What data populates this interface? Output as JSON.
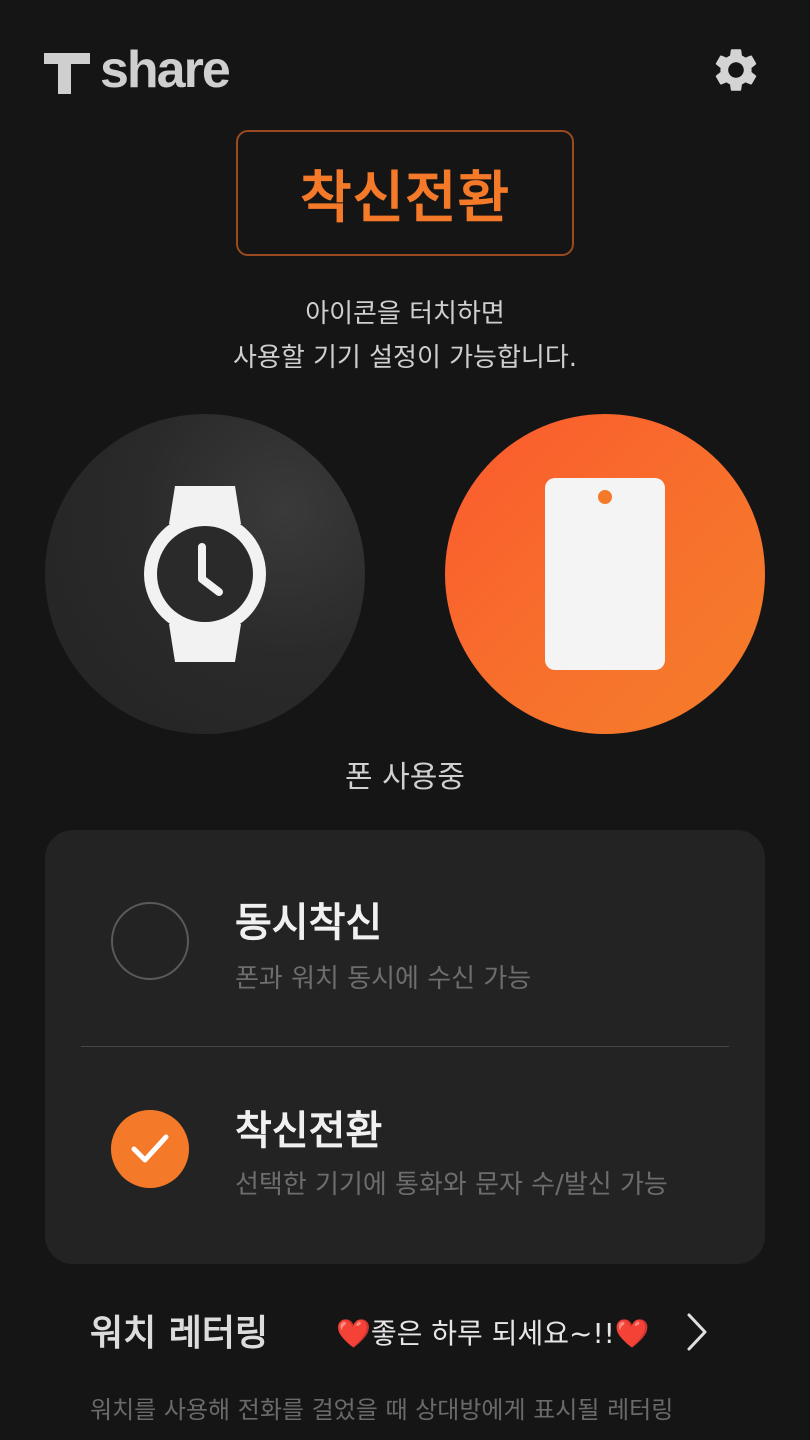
{
  "header": {
    "logo_text": "share",
    "settings_icon": "gear-icon"
  },
  "mode_badge": "착신전환",
  "hint": {
    "line1": "아이콘을 터치하면",
    "line2": "사용할 기기 설정이 가능합니다."
  },
  "devices": {
    "watch": {
      "icon": "watch-icon",
      "selected": false
    },
    "phone": {
      "icon": "phone-icon",
      "selected": true,
      "accent": "#f47a2a"
    }
  },
  "status_text": "폰 사용중",
  "options": [
    {
      "title": "동시착신",
      "description": "폰과 워치 동시에 수신 가능",
      "selected": false
    },
    {
      "title": "착신전환",
      "description": "선택한 기기에 통화와 문자 수/발신 가능",
      "selected": true
    }
  ],
  "ringing": {
    "label": "워치 레터링",
    "value": "❤️좋은 하루 되세요~!!❤️",
    "chevron_icon": "chevron-right-icon",
    "footnote": "워치를 사용해 전화를 걸었을 때 상대방에게 표시될 레터링"
  },
  "colors": {
    "accent": "#f47a2a",
    "background": "#151515",
    "card": "#232323"
  }
}
